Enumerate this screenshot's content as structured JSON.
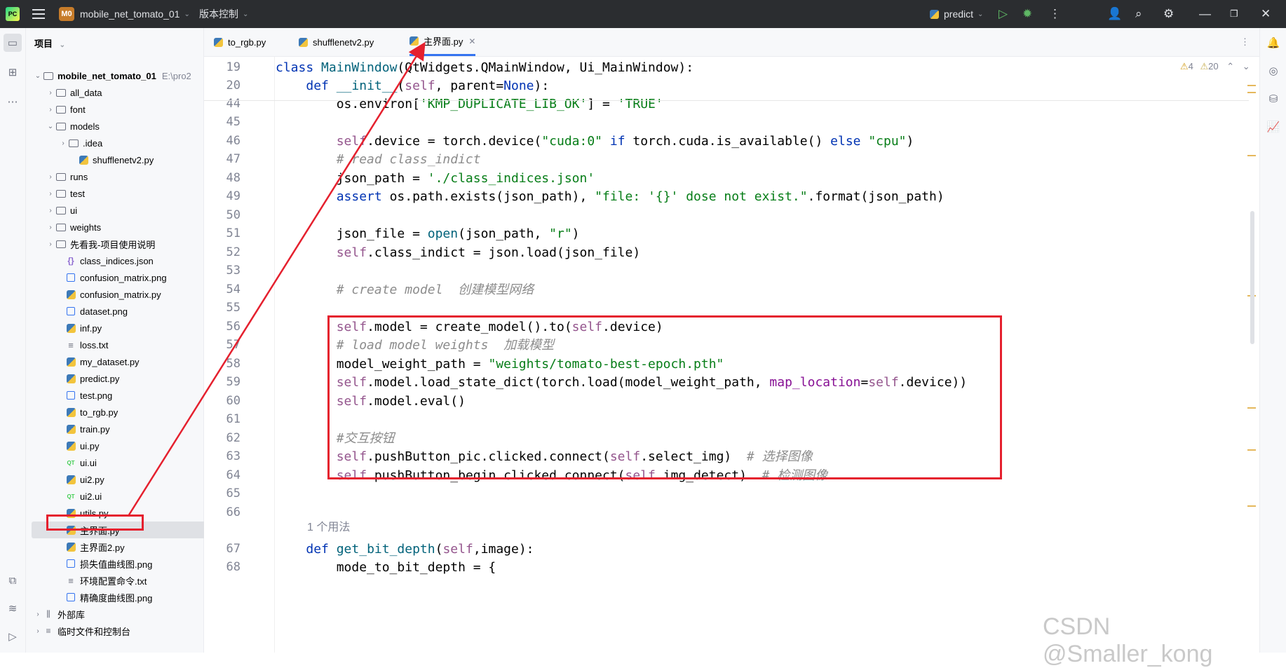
{
  "titlebar": {
    "project_badge": "M0",
    "project_name": "mobile_net_tomato_01",
    "vcs_label": "版本控制",
    "run_config": "predict"
  },
  "project_panel": {
    "header": "项目",
    "tree": [
      {
        "label": "mobile_net_tomato_01",
        "extra": "E:\\pro2",
        "type": "folder",
        "expanded": true
      },
      {
        "label": "all_data",
        "type": "folder"
      },
      {
        "label": "font",
        "type": "folder"
      },
      {
        "label": "models",
        "type": "folder",
        "expanded": true
      },
      {
        "label": ".idea",
        "type": "folder"
      },
      {
        "label": "shufflenetv2.py",
        "type": "py"
      },
      {
        "label": "runs",
        "type": "folder"
      },
      {
        "label": "test",
        "type": "folder"
      },
      {
        "label": "ui",
        "type": "folder"
      },
      {
        "label": "weights",
        "type": "folder"
      },
      {
        "label": "先看我-项目使用说明",
        "type": "folder"
      },
      {
        "label": "class_indices.json",
        "type": "json"
      },
      {
        "label": "confusion_matrix.png",
        "type": "img"
      },
      {
        "label": "confusion_matrix.py",
        "type": "py"
      },
      {
        "label": "dataset.png",
        "type": "img"
      },
      {
        "label": "inf.py",
        "type": "py"
      },
      {
        "label": "loss.txt",
        "type": "txt"
      },
      {
        "label": "my_dataset.py",
        "type": "py"
      },
      {
        "label": "predict.py",
        "type": "py"
      },
      {
        "label": "test.png",
        "type": "img"
      },
      {
        "label": "to_rgb.py",
        "type": "py"
      },
      {
        "label": "train.py",
        "type": "py"
      },
      {
        "label": "ui.py",
        "type": "py"
      },
      {
        "label": "ui.ui",
        "type": "qt"
      },
      {
        "label": "ui2.py",
        "type": "py"
      },
      {
        "label": "ui2.ui",
        "type": "qt"
      },
      {
        "label": "utils.py",
        "type": "py"
      },
      {
        "label": "主界面.py",
        "type": "py",
        "selected": true
      },
      {
        "label": "主界面2.py",
        "type": "py"
      },
      {
        "label": "损失值曲线图.png",
        "type": "img"
      },
      {
        "label": "环境配置命令.txt",
        "type": "txt"
      },
      {
        "label": "精确度曲线图.png",
        "type": "img"
      },
      {
        "label": "外部库",
        "type": "lib"
      },
      {
        "label": "临时文件和控制台",
        "type": "scratch"
      }
    ]
  },
  "tabs": [
    {
      "label": "to_rgb.py",
      "active": false
    },
    {
      "label": "shufflenetv2.py",
      "active": false
    },
    {
      "label": "主界面.py",
      "active": true
    }
  ],
  "editor": {
    "warnings": "4",
    "weak_warnings": "20",
    "usage_hint": "1 个用法",
    "lines": [
      {
        "n": "19",
        "tokens": [
          [
            "kw",
            "class "
          ],
          [
            "fnname",
            "MainWindow"
          ],
          [
            "",
            "(QtWidgets.QMainWindow, Ui_MainWindow):"
          ]
        ]
      },
      {
        "n": "20",
        "tokens": [
          [
            "",
            "    "
          ],
          [
            "kw",
            "def "
          ],
          [
            "fnname",
            "__init__"
          ],
          [
            "",
            "("
          ],
          [
            "slf",
            "self"
          ],
          [
            "",
            ", parent="
          ],
          [
            "kw",
            "None"
          ],
          [
            "",
            "):"
          ]
        ]
      },
      {
        "n": "44",
        "tokens": [
          [
            "",
            "        os.environ["
          ],
          [
            "str",
            "'KMP_DUPLICATE_LIB_OK'"
          ],
          [
            "",
            "] = "
          ],
          [
            "str",
            "'TRUE'"
          ]
        ]
      },
      {
        "n": "45",
        "tokens": []
      },
      {
        "n": "46",
        "tokens": [
          [
            "",
            "        "
          ],
          [
            "slf",
            "self"
          ],
          [
            "",
            ".device = torch.device("
          ],
          [
            "str",
            "\"cuda:0\""
          ],
          [
            "kw",
            " if "
          ],
          [
            "",
            "torch.cuda.is_available() "
          ],
          [
            "kw",
            "else "
          ],
          [
            "str",
            "\"cpu\""
          ],
          [
            "",
            ")"
          ]
        ]
      },
      {
        "n": "47",
        "tokens": [
          [
            "cm",
            "        # read class_indict"
          ]
        ]
      },
      {
        "n": "48",
        "tokens": [
          [
            "",
            "        json_path = "
          ],
          [
            "str",
            "'./class_indices.json'"
          ]
        ]
      },
      {
        "n": "49",
        "tokens": [
          [
            "kw",
            "        assert "
          ],
          [
            "",
            "os.path.exists(json_path), "
          ],
          [
            "str",
            "\"file: '{}' dose not exist.\""
          ],
          [
            "",
            ".format(json_path)"
          ]
        ]
      },
      {
        "n": "50",
        "tokens": []
      },
      {
        "n": "51",
        "tokens": [
          [
            "",
            "        json_file = "
          ],
          [
            "fnname",
            "open"
          ],
          [
            "",
            "(json_path, "
          ],
          [
            "str",
            "\"r\""
          ],
          [
            "",
            ")"
          ]
        ]
      },
      {
        "n": "52",
        "tokens": [
          [
            "",
            "        "
          ],
          [
            "slf",
            "self"
          ],
          [
            "",
            ".class_indict = json.load(json_file)"
          ]
        ]
      },
      {
        "n": "53",
        "tokens": []
      },
      {
        "n": "54",
        "tokens": [
          [
            "cm",
            "        # create model  创建模型网络"
          ]
        ]
      },
      {
        "n": "55",
        "tokens": []
      },
      {
        "n": "56",
        "tokens": [
          [
            "",
            "        "
          ],
          [
            "slf",
            "self"
          ],
          [
            "",
            ".model = create_model().to("
          ],
          [
            "slf",
            "self"
          ],
          [
            "",
            ".device)"
          ]
        ]
      },
      {
        "n": "57",
        "tokens": [
          [
            "cm",
            "        # load model weights  加载模型"
          ]
        ]
      },
      {
        "n": "58",
        "tokens": [
          [
            "",
            "        model_weight_path = "
          ],
          [
            "str",
            "\"weights/tomato-best-epoch.pth\""
          ]
        ]
      },
      {
        "n": "59",
        "tokens": [
          [
            "",
            "        "
          ],
          [
            "slf",
            "self"
          ],
          [
            "",
            ".model.load_state_dict(torch.load(model_weight_path, "
          ],
          [
            "prm",
            "map_location"
          ],
          [
            "",
            "="
          ],
          [
            "slf",
            "self"
          ],
          [
            "",
            ".device))"
          ]
        ]
      },
      {
        "n": "60",
        "tokens": [
          [
            "",
            "        "
          ],
          [
            "slf",
            "self"
          ],
          [
            "",
            ".model.eval()"
          ]
        ]
      },
      {
        "n": "61",
        "tokens": []
      },
      {
        "n": "62",
        "tokens": [
          [
            "cm",
            "        #交互按钮"
          ]
        ]
      },
      {
        "n": "63",
        "tokens": [
          [
            "",
            "        "
          ],
          [
            "slf",
            "self"
          ],
          [
            "",
            ".pushButton_pic.clicked.connect("
          ],
          [
            "slf",
            "self"
          ],
          [
            "",
            ".select_img)  "
          ],
          [
            "cm",
            "# 选择图像"
          ]
        ]
      },
      {
        "n": "64",
        "tokens": [
          [
            "",
            "        "
          ],
          [
            "slf",
            "self"
          ],
          [
            "",
            ".pushButton_begin.clicked.connect("
          ],
          [
            "slf",
            "self"
          ],
          [
            "",
            ".img_detect)  "
          ],
          [
            "cm",
            "# 检测图像"
          ]
        ]
      },
      {
        "n": "65",
        "tokens": []
      },
      {
        "n": "66",
        "tokens": []
      },
      {
        "n": "",
        "usage": true
      },
      {
        "n": "67",
        "tokens": [
          [
            "",
            "    "
          ],
          [
            "kw",
            "def "
          ],
          [
            "fnname",
            "get_bit_depth"
          ],
          [
            "",
            "("
          ],
          [
            "slf",
            "self"
          ],
          [
            "",
            ",image):"
          ]
        ]
      },
      {
        "n": "68",
        "tokens": [
          [
            "",
            "        mode_to_bit_depth = {"
          ]
        ]
      }
    ]
  },
  "watermark": "CSDN @Smaller_kong",
  "colors": {
    "annotation": "#e5202e",
    "accent": "#3574f0"
  }
}
